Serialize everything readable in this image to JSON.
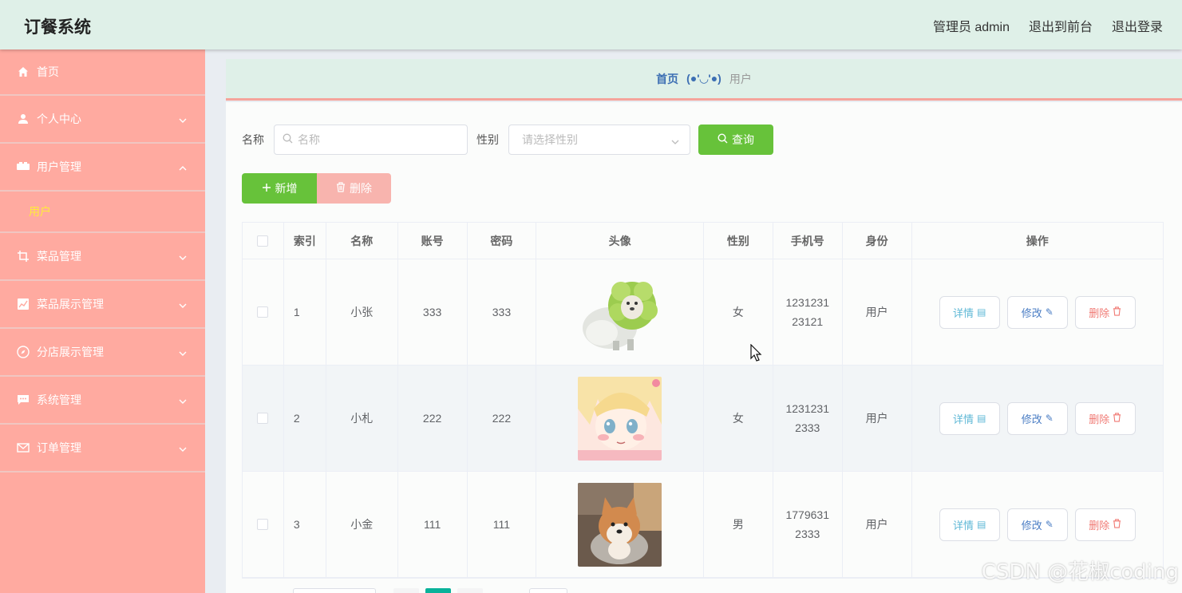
{
  "header": {
    "title": "订餐系统",
    "admin_label": "管理员 admin",
    "to_front": "退出到前台",
    "logout": "退出登录"
  },
  "sidebar": {
    "items": [
      {
        "label": "首页",
        "icon": "home-icon"
      },
      {
        "label": "个人中心",
        "icon": "user-icon"
      },
      {
        "label": "用户管理",
        "icon": "users-icon",
        "expanded": true,
        "sub": "用户"
      },
      {
        "label": "菜品管理",
        "icon": "crop-icon"
      },
      {
        "label": "菜品展示管理",
        "icon": "chart-icon"
      },
      {
        "label": "分店展示管理",
        "icon": "compass-icon"
      },
      {
        "label": "系统管理",
        "icon": "message-icon"
      },
      {
        "label": "订单管理",
        "icon": "mail-icon"
      }
    ]
  },
  "breadcrumb": {
    "home": "首页",
    "face": "(●'◡'●)",
    "current": "用户"
  },
  "search": {
    "name_label": "名称",
    "name_placeholder": "名称",
    "sex_label": "性别",
    "sex_placeholder": "请选择性别",
    "query_button": "查询"
  },
  "actions": {
    "add": "新增",
    "delete": "删除"
  },
  "table": {
    "headers": [
      "索引",
      "名称",
      "账号",
      "密码",
      "头像",
      "性别",
      "手机号",
      "身份",
      "操作"
    ],
    "rows": [
      {
        "index": "1",
        "name": "小张",
        "account": "333",
        "password": "333",
        "avatar": "cabbage-dog-image",
        "sex": "女",
        "phone_1": "1231231",
        "phone_2": "23121",
        "role": "用户"
      },
      {
        "index": "2",
        "name": "小札",
        "account": "222",
        "password": "222",
        "avatar": "anime-girl-image",
        "sex": "女",
        "phone_1": "1231231",
        "phone_2": "2333",
        "role": "用户"
      },
      {
        "index": "3",
        "name": "小金",
        "account": "111",
        "password": "111",
        "avatar": "shiba-dog-image",
        "sex": "男",
        "phone_1": "1779631",
        "phone_2": "2333",
        "role": "用户"
      }
    ],
    "op_detail": "详情",
    "op_edit": "修改",
    "op_delete": "删除"
  },
  "watermark": "CSDN @花椒coding",
  "colors": {
    "header_bg": "#dff0e8",
    "sidebar_bg": "#ffaaa0",
    "submenu_active": "#ffeb3b",
    "primary_green": "#67c23a",
    "danger_light": "#f8b4ae",
    "page_active": "#09b29a"
  }
}
